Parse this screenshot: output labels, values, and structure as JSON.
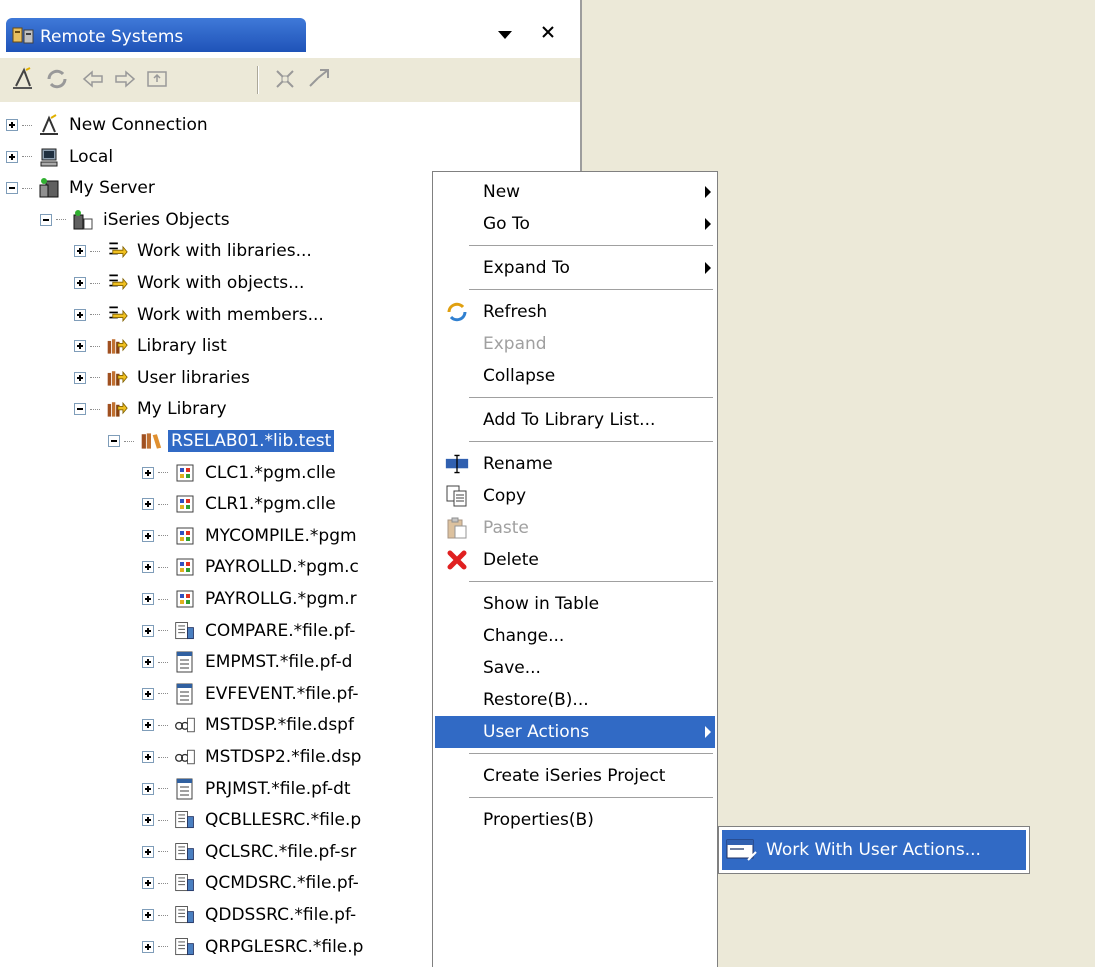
{
  "view": {
    "title": "Remote Systems",
    "icons": {
      "title": "remote-systems-icon",
      "menu": "view-menu-arrow-icon",
      "close": "close-icon"
    }
  },
  "toolbar": {
    "buttons": [
      "new-connection-icon",
      "refresh-icon",
      "back-icon",
      "forward-icon",
      "up-icon",
      "collapse-all-icon",
      "link-with-editor-icon"
    ]
  },
  "tree": {
    "nodes": [
      {
        "label": "New Connection",
        "icon": "new-connection-icon",
        "expander": "plus"
      },
      {
        "label": "Local",
        "icon": "local-computer-icon",
        "expander": "plus"
      },
      {
        "label": "My Server",
        "icon": "server-icon",
        "expander": "minus"
      },
      {
        "label": "iSeries Objects",
        "icon": "iseries-objects-icon",
        "expander": "minus"
      },
      {
        "label": "Work with libraries...",
        "icon": "filter-arrow-icon",
        "expander": "plus"
      },
      {
        "label": "Work with objects...",
        "icon": "filter-arrow-icon",
        "expander": "plus"
      },
      {
        "label": "Work with members...",
        "icon": "filter-arrow-icon",
        "expander": "plus"
      },
      {
        "label": "Library list",
        "icon": "library-filter-icon",
        "expander": "plus"
      },
      {
        "label": "User libraries",
        "icon": "library-filter-icon",
        "expander": "plus"
      },
      {
        "label": "My Library",
        "icon": "library-filter-icon",
        "expander": "minus"
      },
      {
        "label": "RSELAB01.*lib.test",
        "icon": "library-icon",
        "expander": "minus",
        "selected": true
      },
      {
        "label": "CLC1.*pgm.clle",
        "icon": "program-icon",
        "expander": "plus"
      },
      {
        "label": "CLR1.*pgm.clle",
        "icon": "program-icon",
        "expander": "plus"
      },
      {
        "label": "MYCOMPILE.*pgm",
        "icon": "program-icon",
        "expander": "plus"
      },
      {
        "label": "PAYROLLD.*pgm.c",
        "icon": "program-icon",
        "expander": "plus"
      },
      {
        "label": "PAYROLLG.*pgm.r",
        "icon": "program-icon",
        "expander": "plus"
      },
      {
        "label": "COMPARE.*file.pf-",
        "icon": "source-file-icon",
        "expander": "plus"
      },
      {
        "label": "EMPMST.*file.pf-d",
        "icon": "data-file-icon",
        "expander": "plus"
      },
      {
        "label": "EVFEVENT.*file.pf-",
        "icon": "data-file-icon",
        "expander": "plus"
      },
      {
        "label": "MSTDSP.*file.dspf",
        "icon": "display-file-icon",
        "expander": "plus"
      },
      {
        "label": "MSTDSP2.*file.dsp",
        "icon": "display-file-icon",
        "expander": "plus"
      },
      {
        "label": "PRJMST.*file.pf-dt",
        "icon": "data-file-icon",
        "expander": "plus"
      },
      {
        "label": "QCBLLESRC.*file.p",
        "icon": "source-file-icon",
        "expander": "plus"
      },
      {
        "label": "QCLSRC.*file.pf-sr",
        "icon": "source-file-icon",
        "expander": "plus"
      },
      {
        "label": "QCMDSRC.*file.pf-",
        "icon": "source-file-icon",
        "expander": "plus"
      },
      {
        "label": "QDDSSRC.*file.pf-",
        "icon": "source-file-icon",
        "expander": "plus"
      },
      {
        "label": "QRPGLESRC.*file.p",
        "icon": "source-file-icon",
        "expander": "plus"
      }
    ]
  },
  "context_menu": {
    "items": [
      {
        "label": "New",
        "submenu": true
      },
      {
        "label": "Go To",
        "submenu": true
      },
      {
        "separator": true
      },
      {
        "label": "Expand To",
        "submenu": true
      },
      {
        "separator": true
      },
      {
        "label": "Refresh",
        "icon": "refresh-icon"
      },
      {
        "label": "Expand",
        "disabled": true
      },
      {
        "label": "Collapse"
      },
      {
        "separator": true
      },
      {
        "label": "Add To Library List..."
      },
      {
        "separator": true
      },
      {
        "label": "Rename",
        "icon": "rename-icon"
      },
      {
        "label": "Copy",
        "icon": "copy-icon"
      },
      {
        "label": "Paste",
        "icon": "paste-icon",
        "disabled": true
      },
      {
        "label": "Delete",
        "icon": "delete-icon"
      },
      {
        "separator": true
      },
      {
        "label": "Show in Table"
      },
      {
        "label": "Change..."
      },
      {
        "label": "Save..."
      },
      {
        "label": "Restore(B)..."
      },
      {
        "label": "User Actions",
        "submenu": true,
        "highlighted": true
      },
      {
        "separator": true
      },
      {
        "label": "Create iSeries Project"
      },
      {
        "separator": true
      },
      {
        "label": "Properties(B)"
      }
    ]
  },
  "submenu": {
    "items": [
      {
        "label": "Work With User Actions...",
        "icon": "work-with-user-actions-icon",
        "highlighted": true
      }
    ]
  },
  "colors": {
    "selection": "#316ac5",
    "tab_blue": "#2a5fc4",
    "background": "#ece9d8"
  }
}
